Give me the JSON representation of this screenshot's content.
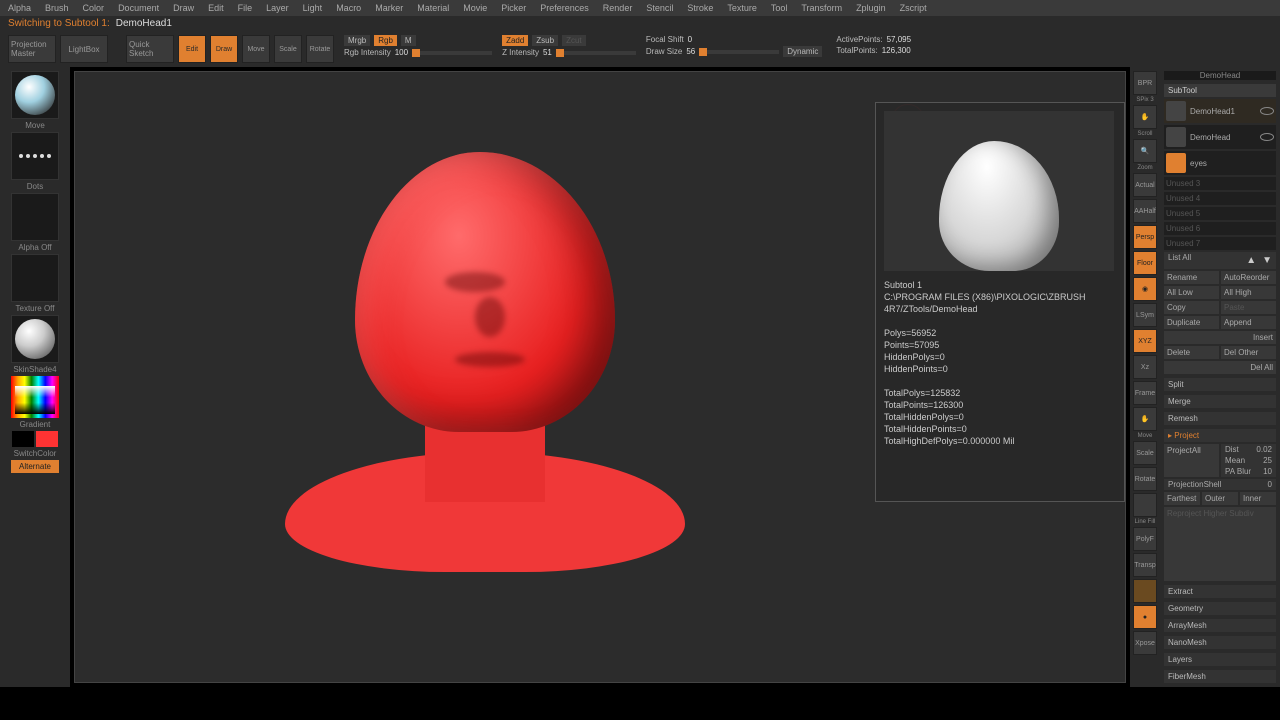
{
  "menu": [
    "Alpha",
    "Brush",
    "Color",
    "Document",
    "Draw",
    "Edit",
    "File",
    "Layer",
    "Light",
    "Macro",
    "Marker",
    "Material",
    "Movie",
    "Picker",
    "Preferences",
    "Render",
    "Stencil",
    "Stroke",
    "Texture",
    "Tool",
    "Transform",
    "Zplugin",
    "Zscript"
  ],
  "status": {
    "prefix": "Switching to Subtool 1:",
    "name": "DemoHead1"
  },
  "toolbar": {
    "projection_master": "Projection Master",
    "lightbox": "LightBox",
    "quick_sketch": "Quick Sketch",
    "edit": "Edit",
    "draw": "Draw",
    "move": "Move",
    "scale": "Scale",
    "rotate": "Rotate",
    "mrgb": "Mrgb",
    "rgb": "Rgb",
    "m": "M",
    "rgb_intensity_label": "Rgb Intensity",
    "rgb_intensity": "100",
    "zadd": "Zadd",
    "zsub": "Zsub",
    "zcut": "Zcut",
    "z_intensity_label": "Z Intensity",
    "z_intensity": "51",
    "focal_shift_label": "Focal Shift",
    "focal_shift": "0",
    "draw_size_label": "Draw Size",
    "draw_size": "56",
    "dynamic": "Dynamic",
    "active_points_label": "ActivePoints:",
    "active_points": "57,095",
    "total_points_label": "TotalPoints:",
    "total_points": "126,300"
  },
  "left": {
    "brush": "Move",
    "stroke": "Dots",
    "alpha": "Alpha Off",
    "texture": "Texture Off",
    "material": "SkinShade4",
    "gradient": "Gradient",
    "switch": "SwitchColor",
    "alternate": "Alternate"
  },
  "right_tb": {
    "bpr": "BPR",
    "spix_lbl": "SPix",
    "spix": "3",
    "scroll": "Scroll",
    "zoom": "Zoom",
    "actual": "Actual",
    "aahalf": "AAHalf",
    "persp": "Persp",
    "floor": "Floor",
    "local": "Local",
    "lsym": "LSym",
    "xyz": "XYZ",
    "xy": "Xz",
    "frame": "Frame",
    "move": "Move",
    "scale": "Scale",
    "rotate": "Rotate",
    "linefill": "Line Fill",
    "polyf": "PolyF",
    "transp": "Transp",
    "solo": "Solo",
    "xpose": "Xpose"
  },
  "info": {
    "title": "Subtool 1",
    "path": "C:\\PROGRAM FILES (X86)\\PIXOLOGIC\\ZBRUSH 4R7/ZTools/DemoHead",
    "stats": "Polys=56952\nPoints=57095\nHiddenPolys=0\nHiddenPoints=0\n\nTotalPolys=125832\nTotalPoints=126300\nTotalHiddenPolys=0\nTotalHiddenPoints=0\nTotalHighDefPolys=0.000000 Mil"
  },
  "subtool_panel": {
    "tool_name": "DemoHead",
    "header": "SubTool",
    "items": [
      {
        "name": "DemoHead1"
      },
      {
        "name": "DemoHead"
      },
      {
        "name": "eyes"
      }
    ],
    "slots": [
      "Unused 3",
      "Unused 4",
      "Unused 5",
      "Unused 6",
      "Unused 7"
    ],
    "list_all": "List All",
    "rename": "Rename",
    "autoreorder": "AutoReorder",
    "all_low": "All Low",
    "all_high": "All High",
    "copy": "Copy",
    "paste": "Paste",
    "duplicate": "Duplicate",
    "append": "Append",
    "insert": "Insert",
    "delete": "Delete",
    "del_other": "Del Other",
    "del_all": "Del All",
    "split": "Split",
    "merge": "Merge",
    "remesh": "Remesh",
    "project": "Project",
    "project_all": "ProjectAll",
    "dist_label": "Dist",
    "dist": "0.02",
    "mean_label": "Mean",
    "mean": "25",
    "pa_blur_label": "PA Blur",
    "pa_blur": "10",
    "projection_shell_label": "ProjectionShell",
    "projection_shell": "0",
    "farthest": "Farthest",
    "outer": "Outer",
    "inner": "Inner",
    "reproject": "Reproject Higher Subdiv",
    "extract": "Extract",
    "sections": [
      "Geometry",
      "ArrayMesh",
      "NanoMesh",
      "Layers",
      "FiberMesh"
    ]
  }
}
